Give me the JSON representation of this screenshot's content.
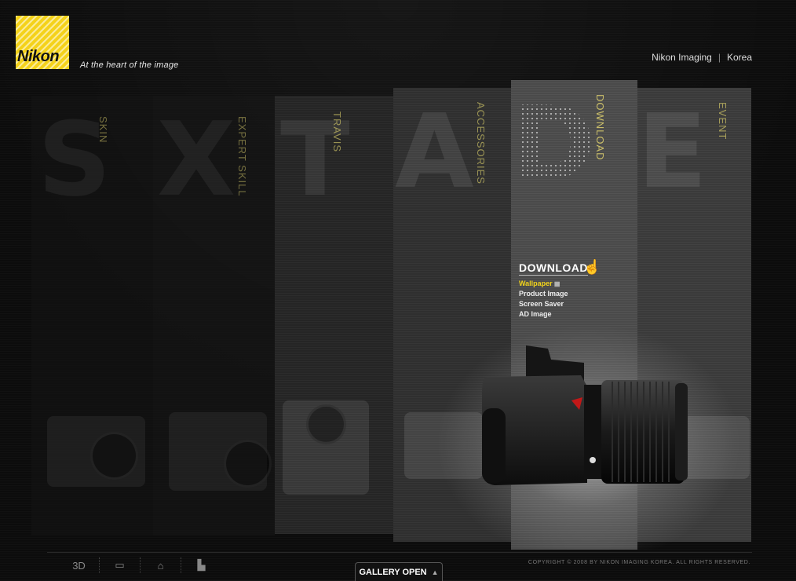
{
  "brand": {
    "logo_text": "Nikon",
    "tagline": "At the heart of the image"
  },
  "topnav": {
    "site": "Nikon Imaging",
    "separator": "|",
    "region": "Korea"
  },
  "panels": [
    {
      "letter": "S",
      "label": "SKIN"
    },
    {
      "letter": "X",
      "label": "EXPERT SKILL"
    },
    {
      "letter": "T",
      "label": "TRAVIS"
    },
    {
      "letter": "A",
      "label": "ACCESSORIES"
    },
    {
      "letter": "D",
      "label": "DOWNLOAD"
    },
    {
      "letter": "E",
      "label": "EVENT"
    }
  ],
  "download_menu": {
    "title": "DOWNLOAD",
    "items": [
      "Wallpaper",
      "Product Image",
      "Screen Saver",
      "AD Image"
    ],
    "active_index": 0
  },
  "bottom": {
    "icons": [
      {
        "name": "3d-icon",
        "glyph": "3D"
      },
      {
        "name": "tv-icon",
        "glyph": "📺"
      },
      {
        "name": "home-icon",
        "glyph": "⌂"
      },
      {
        "name": "chart-icon",
        "glyph": "▙"
      }
    ],
    "gallery_label": "GALLERY OPEN",
    "copyright": "COPYRIGHT © 2008 BY NIKON IMAGING KOREA. ALL RIGHTS RESERVED."
  },
  "colors": {
    "accent": "#f0d21b",
    "logo_yellow": "#f4d21a",
    "background": "#0c0c0c"
  }
}
